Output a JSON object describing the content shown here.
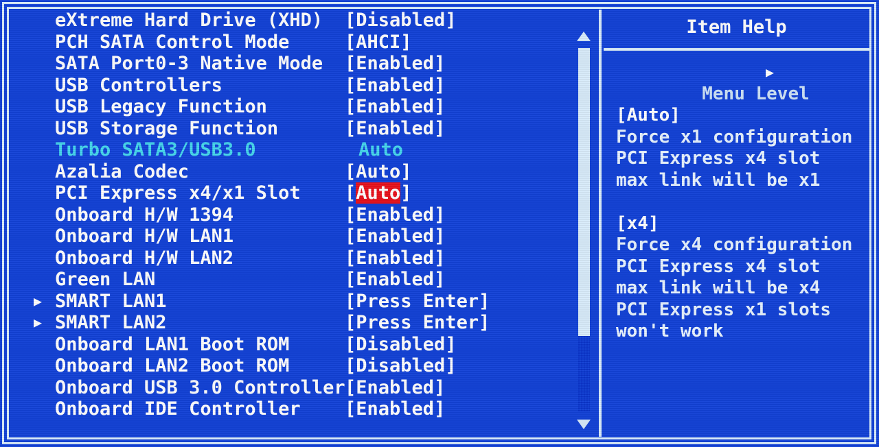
{
  "screen": {
    "background_color": "#1342d8",
    "text_color": "#ffffff",
    "dim_text_color": "#45d6ec",
    "highlight_color": "#e8121c",
    "border_color": "#d9ecfb"
  },
  "menu": {
    "rows": [
      {
        "bullet": "",
        "label": "eXtreme Hard Drive (XHD)",
        "value_prefix": "[",
        "value": "Disabled",
        "value_suffix": "]",
        "dim": false,
        "highlighted": false
      },
      {
        "bullet": "",
        "label": "PCH SATA Control Mode",
        "value_prefix": "[",
        "value": "AHCI",
        "value_suffix": "]",
        "dim": false,
        "highlighted": false
      },
      {
        "bullet": "",
        "label": "SATA Port0-3 Native Mode",
        "value_prefix": "[",
        "value": "Enabled",
        "value_suffix": "]",
        "dim": false,
        "highlighted": false
      },
      {
        "bullet": "",
        "label": "USB Controllers",
        "value_prefix": "[",
        "value": "Enabled",
        "value_suffix": "]",
        "dim": false,
        "highlighted": false
      },
      {
        "bullet": "",
        "label": "USB Legacy Function",
        "value_prefix": "[",
        "value": "Enabled",
        "value_suffix": "]",
        "dim": false,
        "highlighted": false
      },
      {
        "bullet": "",
        "label": "USB Storage Function",
        "value_prefix": "[",
        "value": "Enabled",
        "value_suffix": "]",
        "dim": false,
        "highlighted": false
      },
      {
        "bullet": "",
        "label": "Turbo SATA3/USB3.0",
        "value_prefix": "",
        "value": "Auto",
        "value_suffix": "",
        "dim": true,
        "highlighted": false,
        "value_shift": true
      },
      {
        "bullet": "",
        "label": "Azalia Codec",
        "value_prefix": "[",
        "value": "Auto",
        "value_suffix": "]",
        "dim": false,
        "highlighted": false
      },
      {
        "bullet": "",
        "label": "PCI Express x4/x1 Slot",
        "value_prefix": "[",
        "value": "Auto",
        "value_suffix": "]",
        "dim": false,
        "highlighted": true
      },
      {
        "bullet": "",
        "label": "Onboard H/W 1394",
        "value_prefix": "[",
        "value": "Enabled",
        "value_suffix": "]",
        "dim": false,
        "highlighted": false
      },
      {
        "bullet": "",
        "label": "Onboard H/W LAN1",
        "value_prefix": "[",
        "value": "Enabled",
        "value_suffix": "]",
        "dim": false,
        "highlighted": false
      },
      {
        "bullet": "",
        "label": "Onboard H/W LAN2",
        "value_prefix": "[",
        "value": "Enabled",
        "value_suffix": "]",
        "dim": false,
        "highlighted": false
      },
      {
        "bullet": "",
        "label": "Green LAN",
        "value_prefix": "[",
        "value": "Enabled",
        "value_suffix": "]",
        "dim": false,
        "highlighted": false
      },
      {
        "bullet": "▶",
        "label": "SMART LAN1",
        "value_prefix": "[",
        "value": "Press Enter",
        "value_suffix": "]",
        "dim": false,
        "highlighted": false
      },
      {
        "bullet": "▶",
        "label": "SMART LAN2",
        "value_prefix": "[",
        "value": "Press Enter",
        "value_suffix": "]",
        "dim": false,
        "highlighted": false
      },
      {
        "bullet": "",
        "label": "Onboard LAN1 Boot ROM",
        "value_prefix": "[",
        "value": "Disabled",
        "value_suffix": "]",
        "dim": false,
        "highlighted": false
      },
      {
        "bullet": "",
        "label": "Onboard LAN2 Boot ROM",
        "value_prefix": "[",
        "value": "Disabled",
        "value_suffix": "]",
        "dim": false,
        "highlighted": false
      },
      {
        "bullet": "",
        "label": "Onboard USB 3.0 Controller",
        "value_prefix": "[",
        "value": "Enabled",
        "value_suffix": "]",
        "dim": false,
        "highlighted": false
      },
      {
        "bullet": "",
        "label": "Onboard IDE Controller",
        "value_prefix": "[",
        "value": "Enabled",
        "value_suffix": "]",
        "dim": false,
        "highlighted": false
      }
    ]
  },
  "scrollbar": {
    "up_arrow": "▲",
    "down_arrow": "▼"
  },
  "help": {
    "title": "Item Help",
    "menu_level_label": "Menu Level",
    "menu_level_arrow": "▶",
    "lines": [
      {
        "text": "[Auto]",
        "strong": true
      },
      {
        "text": "Force x1 configuration",
        "strong": false
      },
      {
        "text": "PCI Express x4 slot",
        "strong": false
      },
      {
        "text": "max link will be x1",
        "strong": false
      },
      {
        "text": "",
        "strong": false
      },
      {
        "text": "[x4]",
        "strong": true
      },
      {
        "text": "Force x4 configuration",
        "strong": false
      },
      {
        "text": "PCI Express x4 slot",
        "strong": false
      },
      {
        "text": "max link will be x4",
        "strong": false
      },
      {
        "text": "PCI Express x1 slots",
        "strong": false
      },
      {
        "text": "won't work",
        "strong": false
      }
    ]
  }
}
